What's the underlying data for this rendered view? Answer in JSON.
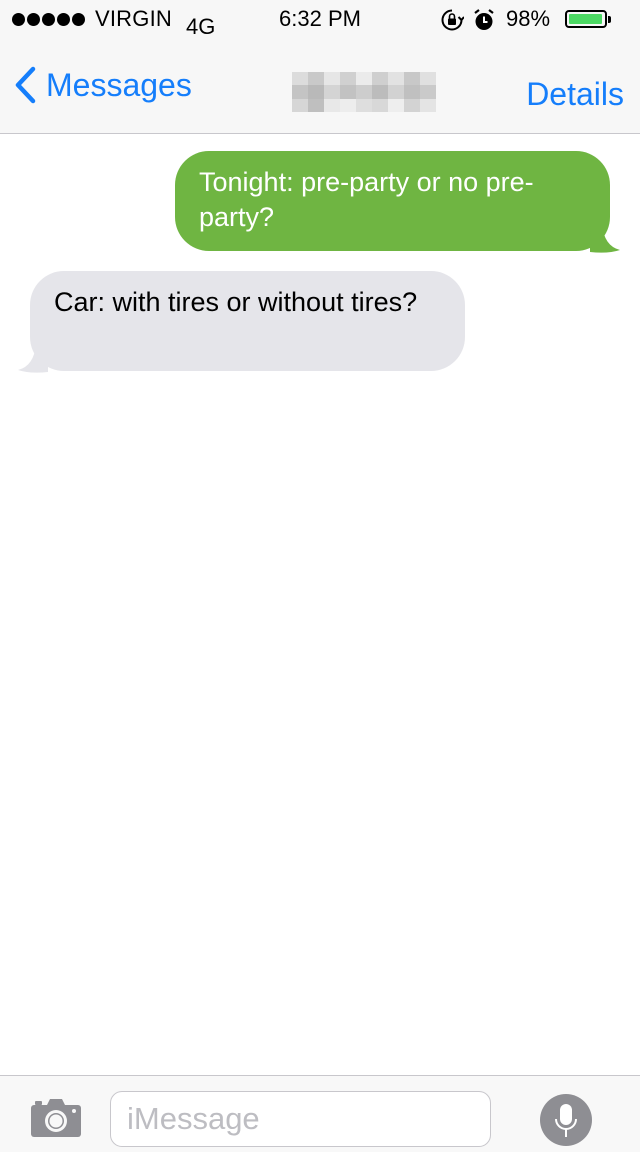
{
  "status_bar": {
    "carrier": "VIRGIN",
    "network": "4G",
    "time": "6:32 PM",
    "battery_percent": "98%",
    "battery_level": 0.98,
    "signal_bars_filled": 5,
    "icons": [
      "signal-icon",
      "rotation-lock-icon",
      "alarm-icon",
      "battery-icon"
    ]
  },
  "nav": {
    "back_label": "Messages",
    "details_label": "Details",
    "contact_name_redacted": true
  },
  "messages": [
    {
      "direction": "outgoing",
      "text": "Tonight: pre-party or no pre-party?"
    },
    {
      "direction": "incoming",
      "text": "Car: with tires or without tires?"
    }
  ],
  "input": {
    "placeholder": "iMessage",
    "value": ""
  },
  "colors": {
    "accent": "#157efb",
    "outgoing_bubble": "#6fb542",
    "incoming_bubble": "#e5e5ea",
    "battery_fill": "#4cd964"
  }
}
